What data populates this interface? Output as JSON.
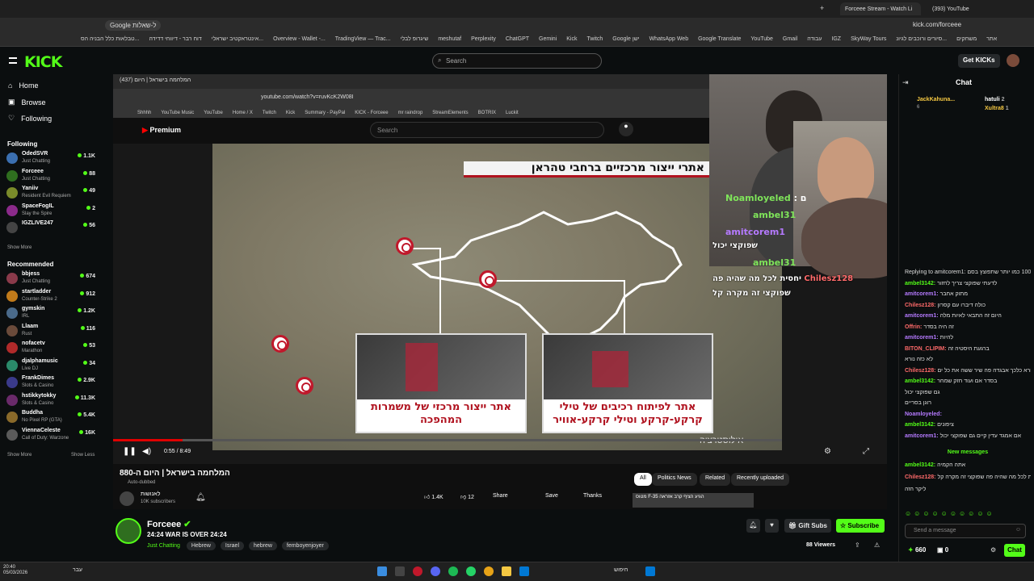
{
  "browser": {
    "tabs": [
      {
        "label": "Forceee Stream - Watch Li",
        "active": true
      },
      {
        "label": "(393) YouTube",
        "active": false
      }
    ],
    "google_chip": "Google ל-שאלות",
    "url": "kick.com/forceee",
    "bookmarks": [
      "טבלאות כלל הבניה הס...",
      "דוח רבר - דיווחי דדידה",
      "אינטראקטיב ישראלי...",
      "Overview - Wallet -...",
      "TradingView — Trac...",
      "שיגרופ לבלי",
      "meshutaf",
      "Perplexity",
      "ChatGPT",
      "Gemini",
      "Kick",
      "Twitch",
      "Google ישן",
      "WhatsApp Web",
      "Google Translate",
      "YouTube",
      "Gmail",
      "עבודה",
      "IGZ",
      "SkyWay Tours",
      "סיורים ורוכבים לגיונ...",
      "משחקים",
      "אתר"
    ]
  },
  "header": {
    "logo": "KICK",
    "search_placeholder": "Search",
    "get_kicks": "Get KICKs"
  },
  "sidebar": {
    "nav": [
      {
        "label": "Home",
        "icon": "home-icon"
      },
      {
        "label": "Browse",
        "icon": "browse-icon"
      },
      {
        "label": "Following",
        "icon": "heart-icon"
      }
    ],
    "following_title": "Following",
    "following": [
      {
        "name": "OdedSVR",
        "category": "Just Chatting",
        "viewers": "1.1K",
        "color": "#3b6fb0"
      },
      {
        "name": "Forceee",
        "category": "Just Chatting",
        "viewers": "88",
        "color": "#2f6e1f"
      },
      {
        "name": "Yaniiv",
        "category": "Resident Evil Requiem",
        "viewers": "49",
        "color": "#7a8b2a"
      },
      {
        "name": "SpaceFogIL",
        "category": "Slay the Spire",
        "viewers": "2",
        "color": "#8b2a8a"
      },
      {
        "name": "IGZLIVE247",
        "category": "",
        "viewers": "56",
        "color": "#444444"
      }
    ],
    "show_more_1": "Show More",
    "recommended_title": "Recommended",
    "recommended": [
      {
        "name": "bbjess",
        "category": "Just Chatting",
        "viewers": "674",
        "color": "#8a3a4a"
      },
      {
        "name": "startladder",
        "category": "Counter-Strike 2",
        "viewers": "912",
        "color": "#c07a1a"
      },
      {
        "name": "gymskin",
        "category": "IRL",
        "viewers": "1.2K",
        "color": "#4a6a8a"
      },
      {
        "name": "Llaam",
        "category": "Rust",
        "viewers": "116",
        "color": "#6a4a3a"
      },
      {
        "name": "nofacetv",
        "category": "Marathon",
        "viewers": "53",
        "color": "#b02a2a"
      },
      {
        "name": "djalphamusic",
        "category": "Live DJ",
        "viewers": "34",
        "color": "#2a8a6a"
      },
      {
        "name": "FrankDimes",
        "category": "Slots & Casino",
        "viewers": "2.9K",
        "color": "#3a3a8a"
      },
      {
        "name": "hstikkytokky",
        "category": "Slots & Casino",
        "viewers": "11.3K",
        "color": "#6a2a6a"
      },
      {
        "name": "Buddha",
        "category": "No Pixel RP (GTA)",
        "viewers": "5.4K",
        "color": "#8a6a2a"
      },
      {
        "name": "ViennaCeleste",
        "category": "Call of Duty: Warzone",
        "viewers": "16K",
        "color": "#5a5a5a"
      }
    ],
    "show_more_2": "Show More",
    "show_less": "Show Less"
  },
  "video": {
    "yt_tab": "המלחמה בישראל | היום (437)",
    "yt_url": "youtube.com/watch?v=ruvKcK2W08I",
    "yt_bookmarks": [
      "Shhhh",
      "YouTube Music",
      "YouTube",
      "Home / X",
      "Twitch",
      "Kick",
      "Summary - PayPal",
      "KICK - Forceee",
      "mr raindrop",
      "StreamElements",
      "BOTRIX",
      "Luckit"
    ],
    "yt_premium": "Premium",
    "yt_search": "Search",
    "headline": "אתרי ייצור מרכזיים ברחבי טהראן",
    "card1": "אתר ייצור מרכזי של משמרות המהפכה",
    "card2": "אתר לפיתוח רכיבים של טילי קרקע-קרקע וטילי קרקע-אוויר",
    "illustration": "אילוסטרציה",
    "time": "0:55 / 8:49",
    "progress": 0.104,
    "overlay_chat": [
      {
        "user": "Noamloyeled",
        "text": ": ם"
      },
      {
        "user": "ambel31",
        "text": ""
      },
      {
        "user": "amitcorem1",
        "text": ""
      },
      {
        "user": "",
        "text": "שפוקצי יכול"
      },
      {
        "user": "ambel31",
        "text": ""
      },
      {
        "user": "Chilesz128",
        "text": "יחסית לכל מה שהיה פה"
      },
      {
        "user": "",
        "text": "שפוקצי זה מקרה קל"
      }
    ]
  },
  "yt_below": {
    "title": "המלחמה בישראל | היום ה-880",
    "auto_dubbed": "Auto-dubbed",
    "channel": "לאנושות",
    "subs": "10K subscribers",
    "likes": "1.4K",
    "dislikes": "12",
    "share": "Share",
    "save": "Save",
    "thanks": "Thanks",
    "filters": [
      "All",
      "Politics News",
      "Related",
      "Recently uploaded"
    ],
    "suggest": "מטוס F-35 הגיע הציף קרב אזראה"
  },
  "channel": {
    "name": "Forceee",
    "title": "24:24 WAR IS OVER 24:24",
    "category": "Just Chatting",
    "tags": [
      "Hebrew",
      "Israel",
      "hebrew",
      "femboyenjoyer"
    ],
    "gift_subs": "Gift Subs",
    "subscribe": "Subscribe",
    "viewers": "88 Viewers"
  },
  "chat": {
    "title": "Chat",
    "pinned": [
      {
        "user": "JackKahuna...",
        "count": "6"
      },
      {
        "user": "hatuli",
        "count": "2"
      },
      {
        "user": "Xultra8",
        "count": "1"
      }
    ],
    "messages": [
      {
        "user": "",
        "text": "Replying to amitcorem1: תחבר100 כמו יותר שתפוצץ בסם",
        "color": "#888888"
      },
      {
        "user": "ambel3142:",
        "text": "לדעתי שפוקצי צריך לחזור",
        "color": "#53fc18"
      },
      {
        "user": "amitcorem1:",
        "text": "מתוק אחבר",
        "color": "#b57aff"
      },
      {
        "user": "Chilesz128:",
        "text": "כולה דיברו עם קסרון",
        "color": "#ff6a6a"
      },
      {
        "user": "amitcorem1:",
        "text": "היום זה התבאי לאיות מלה",
        "color": "#b57aff"
      },
      {
        "user": "Offrin:",
        "text": "זה היה בסדר",
        "color": "#ff6a6a"
      },
      {
        "user": "amitcorem1:",
        "text": "להיות",
        "color": "#b57aff"
      },
      {
        "user": "BITON_CLIPIM:",
        "text": "ברגעת היסטיה זה",
        "color": "#ff6a6a"
      },
      {
        "user": "",
        "text": "לא כזה נורא",
        "color": "#dddddd"
      },
      {
        "user": "Chilesz128:",
        "text": "לא נורא כלכך אבגדה פה שיר ששה את כל ים",
        "color": "#ff6a6a"
      },
      {
        "user": "ambel3142:",
        "text": "בסדר אם ועוד חזק שמחר",
        "color": "#53fc18"
      },
      {
        "user": "",
        "text": "גם שפוקצי יכול",
        "color": "#dddddd"
      },
      {
        "user": "",
        "text": "רוגן בסריים",
        "color": "#dddddd"
      },
      {
        "user": "Noamloyeled:",
        "text": "",
        "color": "#b57aff"
      },
      {
        "user": "ambel3142:",
        "text": "ציפונים",
        "color": "#53fc18"
      },
      {
        "user": "amitcorem1:",
        "text": "אם אמגד עדין קיים גם שפוקצי יכול",
        "color": "#b57aff"
      }
    ],
    "new_messages": "New messages",
    "after_new": [
      {
        "user": "ambel3142:",
        "text": "אתה הקמיה",
        "color": "#53fc18"
      },
      {
        "user": "Chilesz128:",
        "text": "יחסית לכל מה שהיה פה שפוקצי זה מקרה קל",
        "color": "#ff6a6a"
      },
      {
        "user": "",
        "text": "ליקר הזה",
        "color": "#dddddd"
      }
    ],
    "input_placeholder": "Send a message",
    "points": "660",
    "count2": "0",
    "chat_button": "Chat"
  },
  "taskbar": {
    "time": "20:40",
    "date": "05/03/2026",
    "lang": "עבר",
    "search": "חיפוש"
  }
}
